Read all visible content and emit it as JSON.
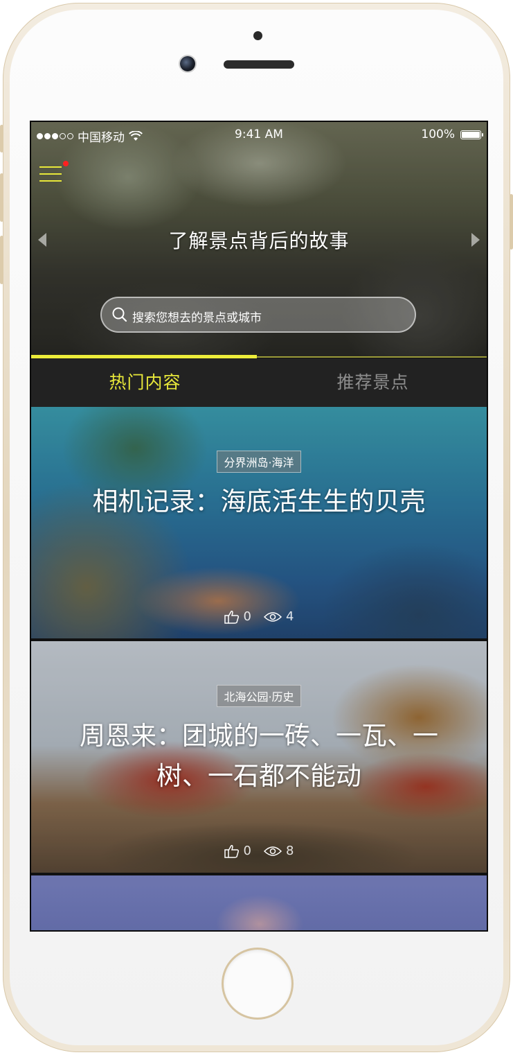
{
  "status_bar": {
    "carrier": "中国移动",
    "time": "9:41 AM",
    "battery": "100%"
  },
  "header": {
    "title": "了解景点背后的故事",
    "search_placeholder": "搜索您想去的景点或城市"
  },
  "tabs": [
    {
      "label": "热门内容",
      "active": true
    },
    {
      "label": "推荐景点",
      "active": false
    }
  ],
  "cards": [
    {
      "tag": "分界洲岛·海洋",
      "title": "相机记录：海底活生生的贝壳",
      "likes": "0",
      "views": "4"
    },
    {
      "tag": "北海公园·历史",
      "title": "周恩来：团城的一砖、一瓦、一树、一石都不能动",
      "likes": "0",
      "views": "8"
    }
  ],
  "colors": {
    "accent": "#e8e83a",
    "notification_dot": "#ff2020",
    "tab_bar_bg": "#222222",
    "tab_inactive": "#8e8e8e"
  }
}
